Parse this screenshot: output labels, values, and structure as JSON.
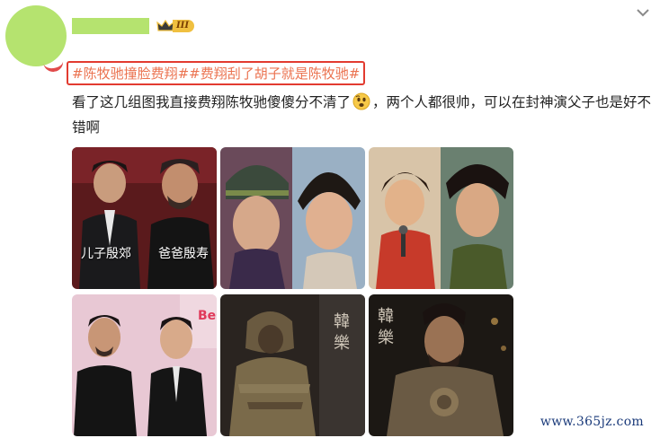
{
  "post": {
    "vip_level": "III",
    "hashtags": [
      "#陈牧驰撞脸费翔#",
      "#费翔刮了胡子就是陈牧驰#"
    ],
    "text_before_emoji": "看了这几组图我直接费翔陈牧驰傻傻分不清了",
    "text_after_emoji": "，两个人都很帅，可以在封神演父子也是好不错啊",
    "emoji": "confused-face-emoji"
  },
  "images": [
    {
      "caption_left": "儿子殷郊",
      "caption_right": "爸爸殷寿"
    },
    {},
    {},
    {},
    {},
    {}
  ],
  "watermark": "www.365jz.com",
  "colors": {
    "hashtag": "#eb7350",
    "highlight_border": "#e23b30",
    "avatar_placeholder": "#b5e36f"
  }
}
